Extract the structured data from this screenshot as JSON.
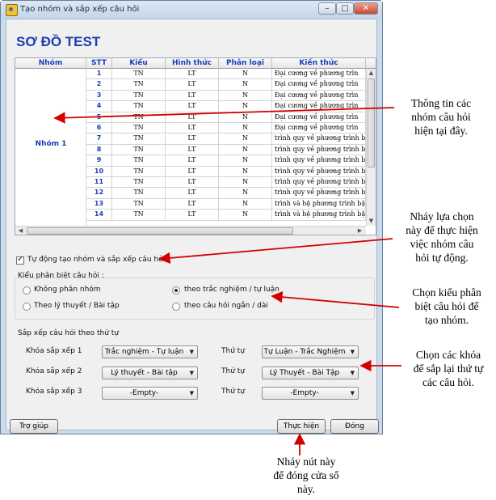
{
  "window": {
    "title": "Tạo nhóm và sắp xếp câu hỏi",
    "minimize": "–",
    "maximize": "□",
    "close": "✕"
  },
  "page_title": "SƠ ĐỒ TEST",
  "grid": {
    "headers": [
      "Nhóm",
      "STT",
      "Kiểu",
      "Hình thức",
      "Phân loại",
      "Kiến thức"
    ],
    "group_label": "Nhóm 1",
    "rows": [
      [
        "1",
        "TN",
        "LT",
        "N",
        "Đại cương về phương trìn"
      ],
      [
        "2",
        "TN",
        "LT",
        "N",
        "Đại cương về phương trìn"
      ],
      [
        "3",
        "TN",
        "LT",
        "N",
        "Đại cương về phương trìn"
      ],
      [
        "4",
        "TN",
        "LT",
        "N",
        "Đại cương về phương trìn"
      ],
      [
        "5",
        "TN",
        "LT",
        "N",
        "Đại cương về phương trìn"
      ],
      [
        "6",
        "TN",
        "LT",
        "N",
        "Đại cương về phương trìn"
      ],
      [
        "7",
        "TN",
        "LT",
        "N",
        "trình quy về phương trình bậc"
      ],
      [
        "8",
        "TN",
        "LT",
        "N",
        "trình quy về phương trình bậc"
      ],
      [
        "9",
        "TN",
        "LT",
        "N",
        "trình quy về phương trình bậc"
      ],
      [
        "10",
        "TN",
        "LT",
        "N",
        "trình quy về phương trình bậc"
      ],
      [
        "11",
        "TN",
        "LT",
        "N",
        "trình quy về phương trình bậc"
      ],
      [
        "12",
        "TN",
        "LT",
        "N",
        "trình quy về phương trình bậc"
      ],
      [
        "13",
        "TN",
        "LT",
        "N",
        "trình và hệ phương trình bậc"
      ],
      [
        "14",
        "TN",
        "LT",
        "N",
        "trình và hệ phương trình bậc"
      ]
    ]
  },
  "auto_group": {
    "label": "Tự động tạo nhóm và sắp xếp câu hỏi",
    "checked": true
  },
  "classify": {
    "title": "Kiểu phân biệt câu hỏi :",
    "options": [
      "Không phân nhóm",
      "theo trắc nghiệm / tự luận",
      "Theo lý thuyết / Bài tập",
      "theo câu hỏi ngắn / dài"
    ],
    "selected": "theo trắc nghiệm / tự luận"
  },
  "sort": {
    "title": "Sắp xếp câu hỏi theo thứ tự",
    "keys": [
      {
        "label": "Khóa sắp xếp 1",
        "value": "Trắc nghiệm - Tự luận",
        "order_label": "Thứ tự",
        "order": "Tự Luận - Trắc Nghiệm"
      },
      {
        "label": "Khóa sắp xếp 2",
        "value": "Lý thuyết - Bài tập",
        "order_label": "Thứ tự",
        "order": "Lý Thuyết - Bài Tập"
      },
      {
        "label": "Khóa sắp xếp 3",
        "value": "-Empty-",
        "order_label": "Thứ tự",
        "order": "-Empty-"
      }
    ]
  },
  "buttons": {
    "help": "Trợ giúp",
    "execute": "Thực hiện",
    "close": "Đóng"
  },
  "annotations": {
    "grid_note": [
      "Thông tin các",
      "nhóm câu hỏi",
      "hiện tại đây."
    ],
    "checkbox_note": [
      "Nháy lựa chọn",
      "này để thực hiện",
      "việc nhóm câu",
      "hỏi tự động."
    ],
    "classify_note": [
      "Chọn kiểu phân",
      "biệt câu hỏi để",
      "tạo nhóm."
    ],
    "sort_note": [
      "Chọn các khóa",
      "để sắp lại thứ tự",
      "các câu hỏi."
    ],
    "execute_note": [
      "Nháy nút này",
      "để đóng cửa sổ",
      "này."
    ]
  },
  "colors": {
    "accent": "#1a3fb5",
    "arrow": "#d40000",
    "window_frame": "#c9dcef"
  }
}
